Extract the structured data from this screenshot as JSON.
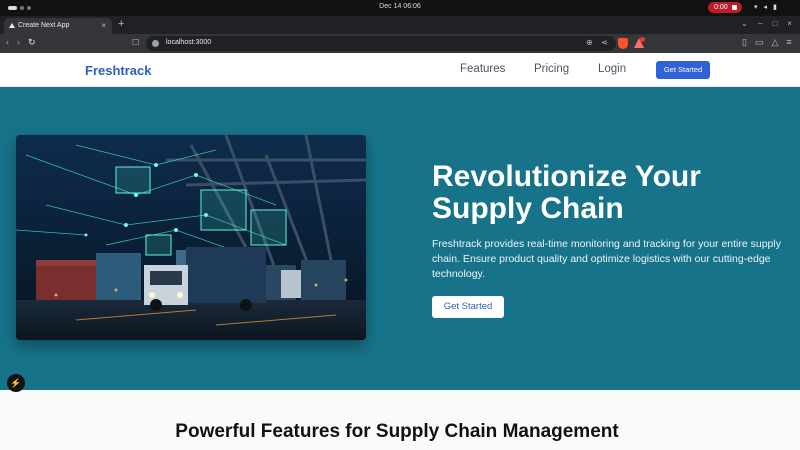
{
  "system": {
    "clock": "Dec 14  06:06",
    "recording_time": "0:00"
  },
  "browser": {
    "tab_title": "Create Next App",
    "url": "localhost:3000"
  },
  "site": {
    "brand": "Freshtrack",
    "nav": [
      {
        "label": "Features"
      },
      {
        "label": "Pricing"
      },
      {
        "label": "Login"
      }
    ],
    "nav_cta": "Get Started"
  },
  "hero": {
    "title": "Revolutionize Your Supply Chain",
    "description": "Freshtrack provides real-time monitoring and tracking for your entire supply chain. Ensure product quality and optimize logistics with our cutting-edge technology.",
    "cta": "Get Started"
  },
  "features": {
    "title": "Powerful Features for Supply Chain Management"
  },
  "colors": {
    "brand": "#2c5fbf",
    "hero_background": "#177389",
    "cta_button": "#2f62d6"
  },
  "icons": [
    "close-icon",
    "plus-icon",
    "back-icon",
    "forward-icon",
    "reload-icon",
    "bookmark-icon",
    "zoom-icon",
    "share-icon",
    "brave-shield-icon",
    "extension-icon",
    "sidebar-icon",
    "wallet-icon",
    "menu-icon",
    "next-logo-icon"
  ]
}
